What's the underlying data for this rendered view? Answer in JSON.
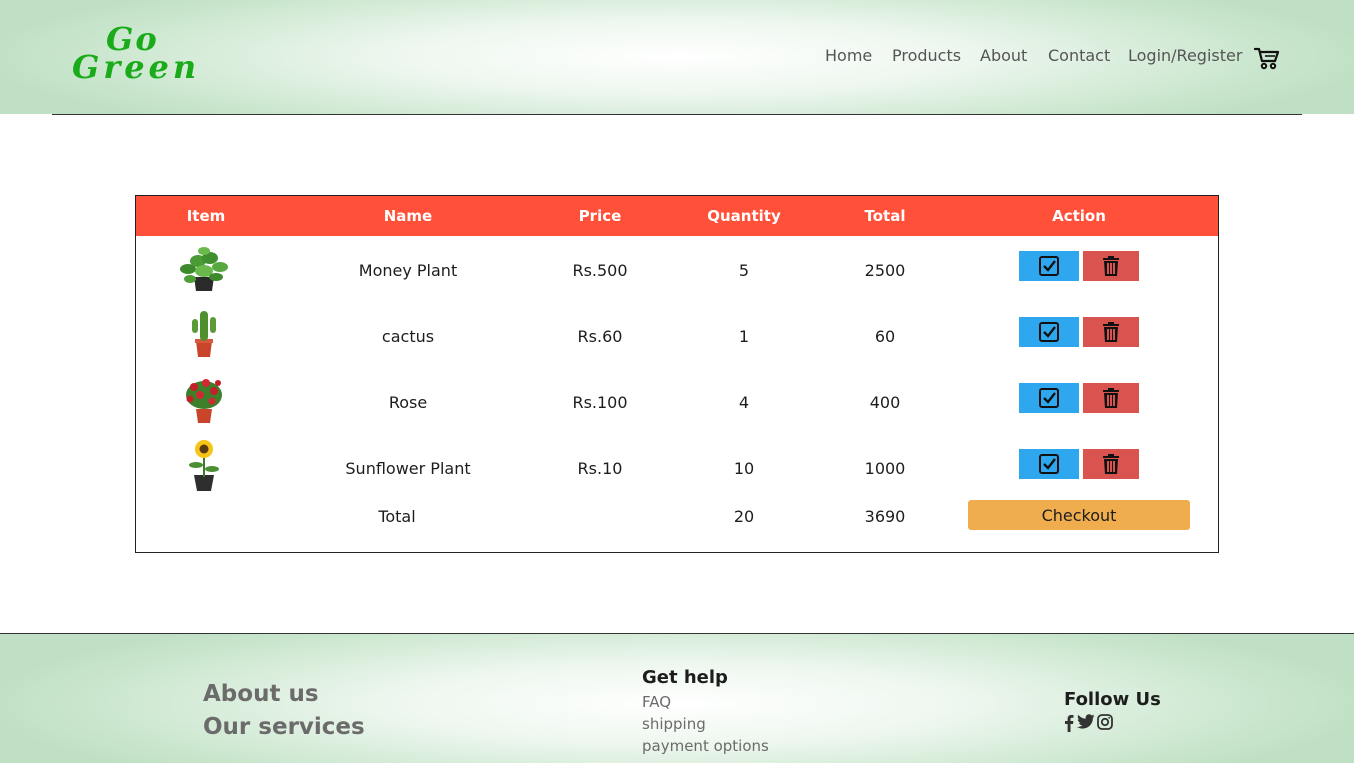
{
  "brand": {
    "logo_top": "Go",
    "logo_bottom": "Green",
    "accent": "#1aab1a"
  },
  "nav": {
    "home": "Home",
    "products": "Products",
    "about": "About",
    "contact": "Contact",
    "login": "Login/Register",
    "cart_icon": "cart-icon"
  },
  "cart": {
    "headers": {
      "item": "Item",
      "name": "Name",
      "price": "Price",
      "quantity": "Quantity",
      "total": "Total",
      "action": "Action"
    },
    "header_color": "#ff513a",
    "rows": [
      {
        "image": "money-plant",
        "name": "Money Plant",
        "price": "Rs.500",
        "quantity": "5",
        "total": "2500"
      },
      {
        "image": "cactus",
        "name": "cactus",
        "price": "Rs.60",
        "quantity": "1",
        "total": "60"
      },
      {
        "image": "rose",
        "name": "Rose",
        "price": "Rs.100",
        "quantity": "4",
        "total": "400"
      },
      {
        "image": "sunflower",
        "name": "Sunflower Plant",
        "price": "Rs.10",
        "quantity": "10",
        "total": "1000"
      }
    ],
    "summary": {
      "label": "Total",
      "quantity": "20",
      "total": "3690"
    },
    "checkout_label": "Checkout",
    "action_icons": {
      "confirm": "check-square-icon",
      "delete": "trash-icon"
    },
    "action_colors": {
      "confirm": "#2fa7ee",
      "delete": "#d9534f",
      "checkout": "#f0ad4e"
    }
  },
  "footer": {
    "about": "About us",
    "services": "Our services",
    "help_heading": "Get help",
    "help_links": [
      "FAQ",
      "shipping",
      "payment options"
    ],
    "follow_heading": "Follow Us",
    "social_icons": [
      "facebook-icon",
      "twitter-icon",
      "instagram-icon"
    ]
  }
}
